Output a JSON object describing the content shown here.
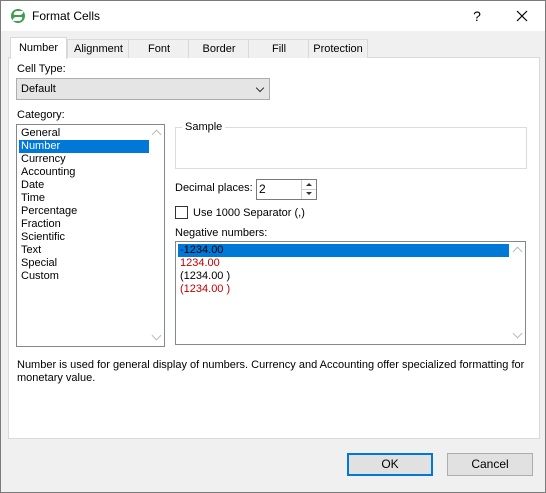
{
  "window": {
    "title": "Format Cells",
    "help_label": "?",
    "close_label": "✕"
  },
  "tabs": [
    {
      "label": "Number",
      "active": true
    },
    {
      "label": "Alignment"
    },
    {
      "label": "Font"
    },
    {
      "label": "Border"
    },
    {
      "label": "Fill"
    },
    {
      "label": "Protection"
    }
  ],
  "cell_type": {
    "label": "Cell Type:",
    "value": "Default"
  },
  "category": {
    "label": "Category:",
    "items": [
      "General",
      "Number",
      "Currency",
      "Accounting",
      "Date",
      "Time",
      "Percentage",
      "Fraction",
      "Scientific",
      "Text",
      "Special",
      "Custom"
    ],
    "selected": "Number"
  },
  "sample": {
    "label": "Sample",
    "value": ""
  },
  "decimal_places": {
    "label": "Decimal places:",
    "value": "2"
  },
  "separator": {
    "label": "Use 1000 Separator (,)",
    "checked": false
  },
  "negative_numbers": {
    "label": "Negative numbers:",
    "items": [
      {
        "text": "-1234.00",
        "color": "#000000",
        "selected": true
      },
      {
        "text": "1234.00",
        "color": "#c00000"
      },
      {
        "text": "(1234.00 )",
        "color": "#000000"
      },
      {
        "text": "(1234.00 )",
        "color": "#c00000"
      }
    ]
  },
  "description": "Number is used for general display of numbers. Currency and Accounting offer specialized formatting for monetary value.",
  "buttons": {
    "ok": "OK",
    "cancel": "Cancel"
  },
  "colors": {
    "selection": "#0078d7",
    "negative_red": "#c00000"
  }
}
